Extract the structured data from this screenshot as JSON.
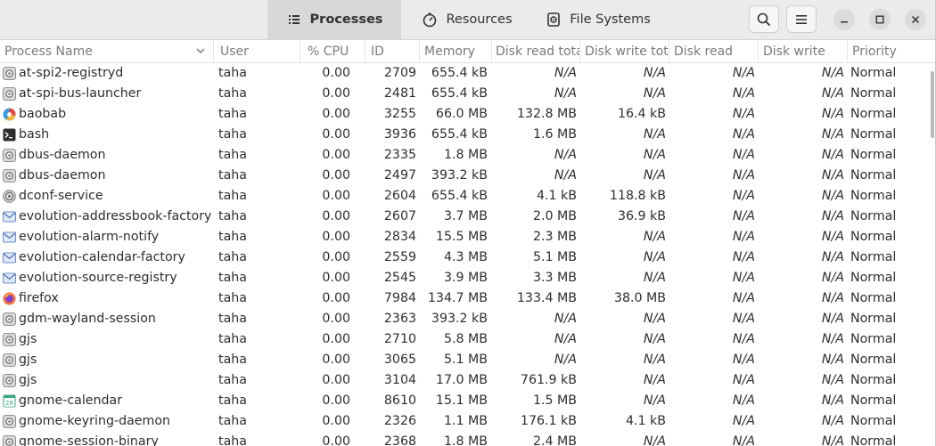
{
  "tabs": [
    {
      "label": "Processes",
      "icon": "list-icon",
      "active": true
    },
    {
      "label": "Resources",
      "icon": "gauge-icon",
      "active": false
    },
    {
      "label": "File Systems",
      "icon": "disk-icon",
      "active": false
    }
  ],
  "columns": [
    "Process Name",
    "User",
    "% CPU",
    "ID",
    "Memory",
    "Disk read tota",
    "Disk write tot",
    "Disk read",
    "Disk write",
    "Priority"
  ],
  "processes": [
    {
      "name": "at-spi2-registryd",
      "icon": "generic-process-icon",
      "user": "taha",
      "cpu": "0.00",
      "id": "2709",
      "memory": "655.4 kB",
      "disk_read_total": "N/A",
      "disk_write_total": "N/A",
      "disk_read": "N/A",
      "disk_write": "N/A",
      "priority": "Normal"
    },
    {
      "name": "at-spi-bus-launcher",
      "icon": "generic-process-icon",
      "user": "taha",
      "cpu": "0.00",
      "id": "2481",
      "memory": "655.4 kB",
      "disk_read_total": "N/A",
      "disk_write_total": "N/A",
      "disk_read": "N/A",
      "disk_write": "N/A",
      "priority": "Normal"
    },
    {
      "name": "baobab",
      "icon": "baobab-icon",
      "user": "taha",
      "cpu": "0.00",
      "id": "3255",
      "memory": "66.0 MB",
      "disk_read_total": "132.8 MB",
      "disk_write_total": "16.4 kB",
      "disk_read": "N/A",
      "disk_write": "N/A",
      "priority": "Normal"
    },
    {
      "name": "bash",
      "icon": "terminal-icon",
      "user": "taha",
      "cpu": "0.00",
      "id": "3936",
      "memory": "655.4 kB",
      "disk_read_total": "1.6 MB",
      "disk_write_total": "N/A",
      "disk_read": "N/A",
      "disk_write": "N/A",
      "priority": "Normal"
    },
    {
      "name": "dbus-daemon",
      "icon": "generic-process-icon",
      "user": "taha",
      "cpu": "0.00",
      "id": "2335",
      "memory": "1.8 MB",
      "disk_read_total": "N/A",
      "disk_write_total": "N/A",
      "disk_read": "N/A",
      "disk_write": "N/A",
      "priority": "Normal"
    },
    {
      "name": "dbus-daemon",
      "icon": "generic-process-icon",
      "user": "taha",
      "cpu": "0.00",
      "id": "2497",
      "memory": "393.2 kB",
      "disk_read_total": "N/A",
      "disk_write_total": "N/A",
      "disk_read": "N/A",
      "disk_write": "N/A",
      "priority": "Normal"
    },
    {
      "name": "dconf-service",
      "icon": "dconf-icon",
      "user": "taha",
      "cpu": "0.00",
      "id": "2604",
      "memory": "655.4 kB",
      "disk_read_total": "4.1 kB",
      "disk_write_total": "118.8 kB",
      "disk_read": "N/A",
      "disk_write": "N/A",
      "priority": "Normal"
    },
    {
      "name": "evolution-addressbook-factory",
      "icon": "evolution-icon",
      "user": "taha",
      "cpu": "0.00",
      "id": "2607",
      "memory": "3.7 MB",
      "disk_read_total": "2.0 MB",
      "disk_write_total": "36.9 kB",
      "disk_read": "N/A",
      "disk_write": "N/A",
      "priority": "Normal"
    },
    {
      "name": "evolution-alarm-notify",
      "icon": "evolution-icon",
      "user": "taha",
      "cpu": "0.00",
      "id": "2834",
      "memory": "15.5 MB",
      "disk_read_total": "2.3 MB",
      "disk_write_total": "N/A",
      "disk_read": "N/A",
      "disk_write": "N/A",
      "priority": "Normal"
    },
    {
      "name": "evolution-calendar-factory",
      "icon": "evolution-icon",
      "user": "taha",
      "cpu": "0.00",
      "id": "2559",
      "memory": "4.3 MB",
      "disk_read_total": "5.1 MB",
      "disk_write_total": "N/A",
      "disk_read": "N/A",
      "disk_write": "N/A",
      "priority": "Normal"
    },
    {
      "name": "evolution-source-registry",
      "icon": "evolution-icon",
      "user": "taha",
      "cpu": "0.00",
      "id": "2545",
      "memory": "3.9 MB",
      "disk_read_total": "3.3 MB",
      "disk_write_total": "N/A",
      "disk_read": "N/A",
      "disk_write": "N/A",
      "priority": "Normal"
    },
    {
      "name": "firefox",
      "icon": "firefox-icon",
      "user": "taha",
      "cpu": "0.00",
      "id": "7984",
      "memory": "134.7 MB",
      "disk_read_total": "133.4 MB",
      "disk_write_total": "38.0 MB",
      "disk_read": "N/A",
      "disk_write": "N/A",
      "priority": "Normal"
    },
    {
      "name": "gdm-wayland-session",
      "icon": "generic-process-icon",
      "user": "taha",
      "cpu": "0.00",
      "id": "2363",
      "memory": "393.2 kB",
      "disk_read_total": "N/A",
      "disk_write_total": "N/A",
      "disk_read": "N/A",
      "disk_write": "N/A",
      "priority": "Normal"
    },
    {
      "name": "gjs",
      "icon": "generic-process-icon",
      "user": "taha",
      "cpu": "0.00",
      "id": "2710",
      "memory": "5.8 MB",
      "disk_read_total": "N/A",
      "disk_write_total": "N/A",
      "disk_read": "N/A",
      "disk_write": "N/A",
      "priority": "Normal"
    },
    {
      "name": "gjs",
      "icon": "generic-process-icon",
      "user": "taha",
      "cpu": "0.00",
      "id": "3065",
      "memory": "5.1 MB",
      "disk_read_total": "N/A",
      "disk_write_total": "N/A",
      "disk_read": "N/A",
      "disk_write": "N/A",
      "priority": "Normal"
    },
    {
      "name": "gjs",
      "icon": "generic-process-icon",
      "user": "taha",
      "cpu": "0.00",
      "id": "3104",
      "memory": "17.0 MB",
      "disk_read_total": "761.9 kB",
      "disk_write_total": "N/A",
      "disk_read": "N/A",
      "disk_write": "N/A",
      "priority": "Normal"
    },
    {
      "name": "gnome-calendar",
      "icon": "calendar-icon",
      "icon_text": "28",
      "user": "taha",
      "cpu": "0.00",
      "id": "8610",
      "memory": "15.1 MB",
      "disk_read_total": "1.5 MB",
      "disk_write_total": "N/A",
      "disk_read": "N/A",
      "disk_write": "N/A",
      "priority": "Normal"
    },
    {
      "name": "gnome-keyring-daemon",
      "icon": "generic-process-icon",
      "user": "taha",
      "cpu": "0.00",
      "id": "2326",
      "memory": "1.1 MB",
      "disk_read_total": "176.1 kB",
      "disk_write_total": "4.1 kB",
      "disk_read": "N/A",
      "disk_write": "N/A",
      "priority": "Normal"
    },
    {
      "name": "gnome-session-binary",
      "icon": "generic-process-icon",
      "user": "taha",
      "cpu": "0.00",
      "id": "2368",
      "memory": "1.8 MB",
      "disk_read_total": "2.4 MB",
      "disk_write_total": "N/A",
      "disk_read": "N/A",
      "disk_write": "N/A",
      "priority": "Normal"
    }
  ]
}
